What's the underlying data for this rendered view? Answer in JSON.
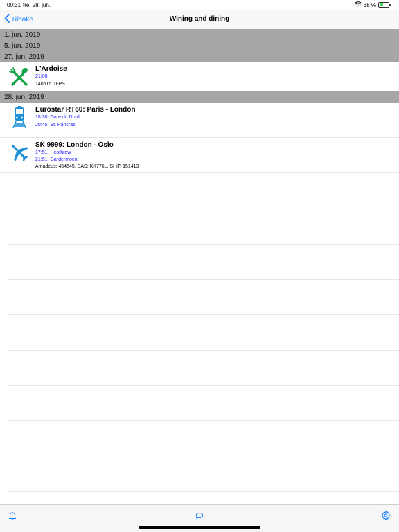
{
  "status_bar": {
    "time": "00:31",
    "date": "fre. 28. jun.",
    "battery_text": "38 %",
    "battery_level": 0.38
  },
  "nav": {
    "back_label": "Tilbake",
    "title": "Wining and dining"
  },
  "sections": [
    {
      "label": "1. jun. 2019"
    },
    {
      "label": "5. jun. 2019"
    },
    {
      "label": "27. jun. 2019"
    },
    {
      "label": "28. jun. 2019"
    }
  ],
  "entries": [
    {
      "icon": "fork-knife-icon",
      "title": "L'Ardoise",
      "line1": "21:00",
      "line2": "14061510-PS"
    },
    {
      "icon": "train-icon",
      "title": "Eurostar RT60: Paris - London",
      "line1": "18:30: Gare du Nord",
      "line2": "20:45: St. Pancras"
    },
    {
      "icon": "airplane-icon",
      "title": "SK 9999: London - Oslo",
      "line1": "17:51: Heathrow",
      "line2": "21:51: Gardermoen",
      "line3": "Amadeus: 454545, SAS: KK776L, SHiT: 151413"
    }
  ],
  "tab_bar": {
    "items": [
      "bell-icon",
      "chat-bubble-icon",
      "gear-icon"
    ]
  },
  "colors": {
    "accent": "#0a7aff",
    "restaurant_icon": "#15a34a",
    "travel_icon": "#1e90d6",
    "section_bg": "#a6a6a6",
    "detail_blue": "#1a1aff"
  }
}
